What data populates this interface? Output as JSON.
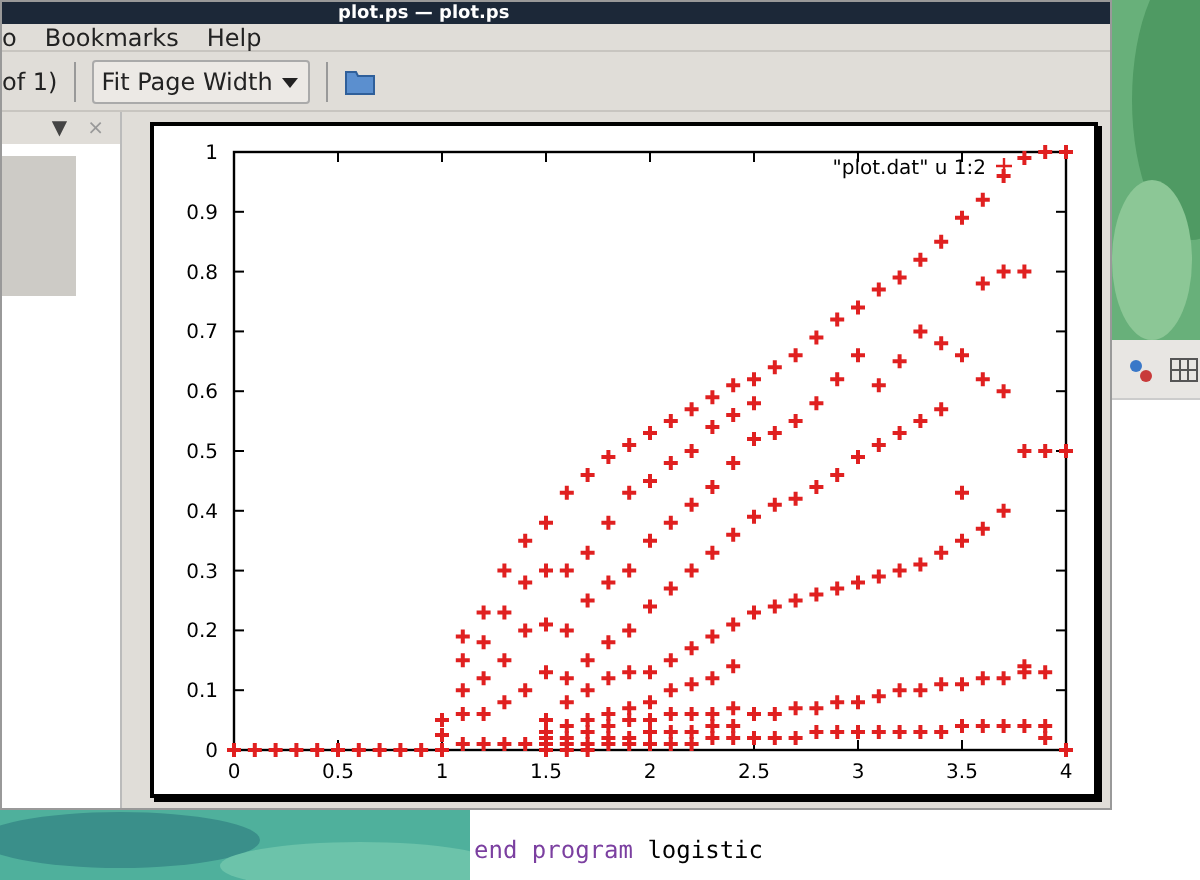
{
  "window": {
    "title": "plot.ps — plot.ps"
  },
  "menu": [
    {
      "label": "o"
    },
    {
      "label": "Bookmarks"
    },
    {
      "label": "Help"
    }
  ],
  "toolbar": {
    "page_count": "of 1)",
    "zoom": "Fit Page Width"
  },
  "sidebar": {
    "menu_arrow": "▼",
    "close": "×"
  },
  "document": {
    "chart_data": {
      "type": "scatter",
      "xlim": [
        0,
        4
      ],
      "ylim": [
        0,
        1
      ],
      "xticks": [
        0,
        0.5,
        1,
        1.5,
        2,
        2.5,
        3,
        3.5,
        4
      ],
      "yticks": [
        0,
        0.1,
        0.2,
        0.3,
        0.4,
        0.5,
        0.6,
        0.7,
        0.8,
        0.9,
        1
      ],
      "x": [
        0,
        0.1,
        0.2,
        0.3,
        0.4,
        0.5,
        0.6,
        0.7,
        0.8,
        0.9,
        1,
        1,
        1,
        1.1,
        1.1,
        1.1,
        1.1,
        1.1,
        1.2,
        1.2,
        1.2,
        1.2,
        1.2,
        1.3,
        1.3,
        1.3,
        1.3,
        1.3,
        1.4,
        1.4,
        1.4,
        1.4,
        1.4,
        1.5,
        1.5,
        1.5,
        1.5,
        1.5,
        1.5,
        1.5,
        1.5,
        1.5,
        1.6,
        1.6,
        1.6,
        1.6,
        1.6,
        1.6,
        1.6,
        1.6,
        1.6,
        1.7,
        1.7,
        1.7,
        1.7,
        1.7,
        1.7,
        1.7,
        1.7,
        1.7,
        1.8,
        1.8,
        1.8,
        1.8,
        1.8,
        1.8,
        1.8,
        1.8,
        1.8,
        1.9,
        1.9,
        1.9,
        1.9,
        1.9,
        1.9,
        1.9,
        1.9,
        1.9,
        2,
        2,
        2,
        2,
        2,
        2,
        2,
        2,
        2,
        2.1,
        2.1,
        2.1,
        2.1,
        2.1,
        2.1,
        2.1,
        2.1,
        2.1,
        2.2,
        2.2,
        2.2,
        2.2,
        2.2,
        2.2,
        2.2,
        2.2,
        2.2,
        2.3,
        2.3,
        2.3,
        2.3,
        2.3,
        2.3,
        2.3,
        2.3,
        2.3,
        2.4,
        2.4,
        2.4,
        2.4,
        2.4,
        2.4,
        2.4,
        2.4,
        2.4,
        2.5,
        2.5,
        2.5,
        2.5,
        2.5,
        2.5,
        2.5,
        2.6,
        2.6,
        2.6,
        2.6,
        2.6,
        2.6,
        2.7,
        2.7,
        2.7,
        2.7,
        2.7,
        2.7,
        2.8,
        2.8,
        2.8,
        2.8,
        2.8,
        2.8,
        2.9,
        2.9,
        2.9,
        2.9,
        2.9,
        2.9,
        3,
        3,
        3,
        3,
        3,
        3,
        3.1,
        3.1,
        3.1,
        3.1,
        3.1,
        3.1,
        3.2,
        3.2,
        3.2,
        3.2,
        3.2,
        3.2,
        3.3,
        3.3,
        3.3,
        3.3,
        3.3,
        3.3,
        3.4,
        3.4,
        3.4,
        3.4,
        3.4,
        3.4,
        3.5,
        3.5,
        3.5,
        3.5,
        3.5,
        3.5,
        3.6,
        3.6,
        3.6,
        3.6,
        3.6,
        3.6,
        3.7,
        3.7,
        3.7,
        3.7,
        3.7,
        3.7,
        3.8,
        3.8,
        3.8,
        3.8,
        3.8,
        3.8,
        3.9,
        3.9,
        3.9,
        3.9,
        3.9,
        4,
        4,
        4
      ],
      "series": [
        {
          "name": "\"plot.dat\" u 1:2",
          "color": "#e02020",
          "values": [
            0,
            0,
            0,
            0,
            0,
            0,
            0,
            0,
            0,
            0,
            0,
            0.025,
            0.05,
            0.01,
            0.06,
            0.1,
            0.15,
            0.19,
            0.01,
            0.06,
            0.12,
            0.18,
            0.23,
            0.01,
            0.08,
            0.15,
            0.23,
            0.3,
            0.01,
            0.1,
            0.2,
            0.28,
            0.35,
            0,
            0.01,
            0.02,
            0.03,
            0.05,
            0.13,
            0.21,
            0.3,
            0.38,
            0,
            0.01,
            0.02,
            0.04,
            0.08,
            0.12,
            0.2,
            0.3,
            0.43,
            0,
            0.01,
            0.03,
            0.05,
            0.1,
            0.15,
            0.25,
            0.33,
            0.46,
            0.01,
            0.02,
            0.04,
            0.06,
            0.12,
            0.18,
            0.28,
            0.38,
            0.49,
            0.01,
            0.02,
            0.05,
            0.07,
            0.13,
            0.2,
            0.3,
            0.43,
            0.51,
            0.01,
            0.03,
            0.05,
            0.08,
            0.13,
            0.24,
            0.35,
            0.45,
            0.53,
            0.01,
            0.03,
            0.06,
            0.1,
            0.15,
            0.27,
            0.38,
            0.48,
            0.55,
            0.01,
            0.03,
            0.06,
            0.11,
            0.17,
            0.3,
            0.41,
            0.5,
            0.57,
            0.02,
            0.04,
            0.06,
            0.12,
            0.19,
            0.33,
            0.44,
            0.54,
            0.59,
            0.02,
            0.04,
            0.07,
            0.14,
            0.21,
            0.36,
            0.48,
            0.56,
            0.61,
            0.02,
            0.06,
            0.23,
            0.39,
            0.52,
            0.58,
            0.62,
            0.02,
            0.06,
            0.24,
            0.41,
            0.53,
            0.64,
            0.02,
            0.07,
            0.25,
            0.42,
            0.55,
            0.66,
            0.03,
            0.07,
            0.26,
            0.44,
            0.58,
            0.69,
            0.03,
            0.08,
            0.27,
            0.46,
            0.62,
            0.72,
            0.03,
            0.08,
            0.28,
            0.49,
            0.66,
            0.74,
            0.03,
            0.09,
            0.29,
            0.51,
            0.61,
            0.77,
            0.03,
            0.1,
            0.3,
            0.53,
            0.65,
            0.79,
            0.03,
            0.1,
            0.31,
            0.55,
            0.7,
            0.82,
            0.03,
            0.11,
            0.33,
            0.57,
            0.68,
            0.85,
            0.04,
            0.11,
            0.35,
            0.43,
            0.66,
            0.89,
            0.04,
            0.12,
            0.37,
            0.62,
            0.78,
            0.92,
            0.04,
            0.12,
            0.4,
            0.6,
            0.8,
            0.96,
            0.04,
            0.13,
            0.14,
            0.5,
            0.8,
            0.99,
            0.04,
            0.13,
            0.02,
            0.5,
            1,
            0,
            0.5,
            1
          ]
        }
      ]
    }
  },
  "editor": {
    "lines": [
      [
        {
          "kind": "keyword",
          "text": "end program"
        },
        {
          "kind": "name",
          "text": "logistic"
        }
      ]
    ]
  }
}
